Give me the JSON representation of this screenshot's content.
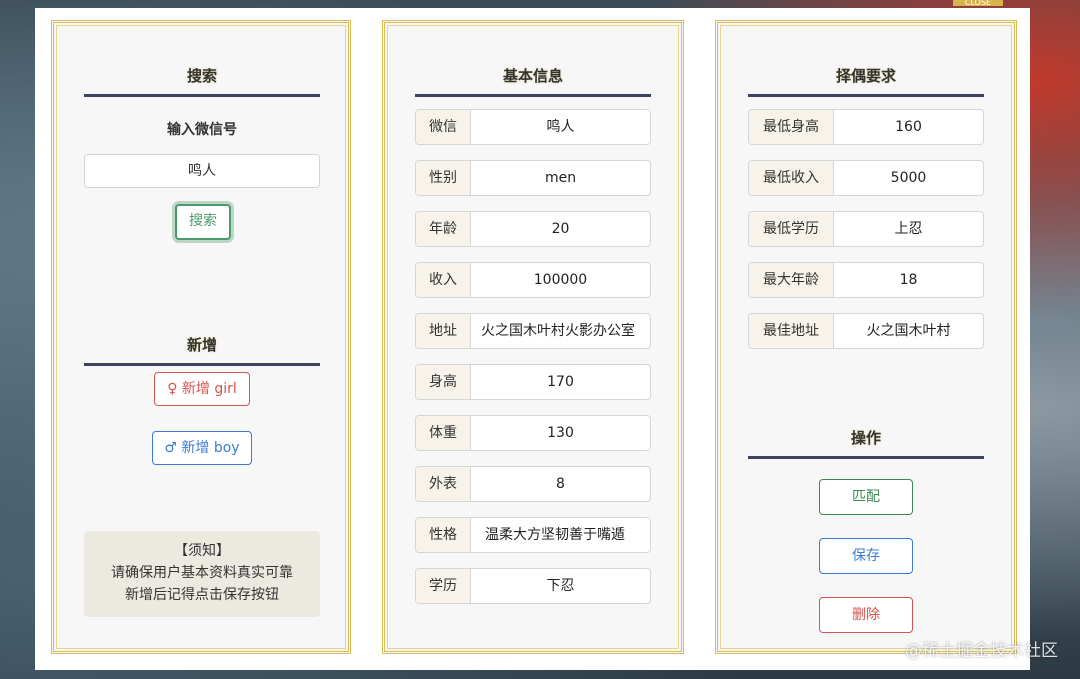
{
  "search": {
    "title": "搜索",
    "input_label": "输入微信号",
    "input_value": "鸣人",
    "button": "搜索"
  },
  "add": {
    "title": "新增",
    "girl_icon": "♀",
    "girl_label": "新增 girl",
    "boy_icon": "♂",
    "boy_label": "新增 boy"
  },
  "notice": {
    "title": "【须知】",
    "line1": "请确保用户基本资料真实可靠",
    "line2": "新增后记得点击保存按钮"
  },
  "basic_info": {
    "title": "基本信息",
    "fields": [
      {
        "label": "微信",
        "value": "鸣人"
      },
      {
        "label": "性别",
        "value": "men"
      },
      {
        "label": "年龄",
        "value": "20"
      },
      {
        "label": "收入",
        "value": "100000"
      },
      {
        "label": "地址",
        "value": "火之国木叶村火影办公室"
      },
      {
        "label": "身高",
        "value": "170"
      },
      {
        "label": "体重",
        "value": "130"
      },
      {
        "label": "外表",
        "value": "8"
      },
      {
        "label": "性格",
        "value": "温柔大方坚韧善于嘴遁"
      },
      {
        "label": "学历",
        "value": "下忍"
      }
    ]
  },
  "requirements": {
    "title": "择偶要求",
    "fields": [
      {
        "label": "最低身高",
        "value": "160"
      },
      {
        "label": "最低收入",
        "value": "5000"
      },
      {
        "label": "最低学历",
        "value": "上忍"
      },
      {
        "label": "最大年龄",
        "value": "18"
      },
      {
        "label": "最佳地址",
        "value": "火之国木叶村"
      }
    ]
  },
  "actions": {
    "title": "操作",
    "match": "匹配",
    "save": "保存",
    "delete": "删除"
  },
  "watermark": "@稀土掘金技术社区",
  "colors": {
    "gold_border": "#d9bd5b",
    "title_line": "#3d4260",
    "green": "#3b8a55",
    "blue": "#3b7bd4",
    "red": "#d9534f"
  }
}
